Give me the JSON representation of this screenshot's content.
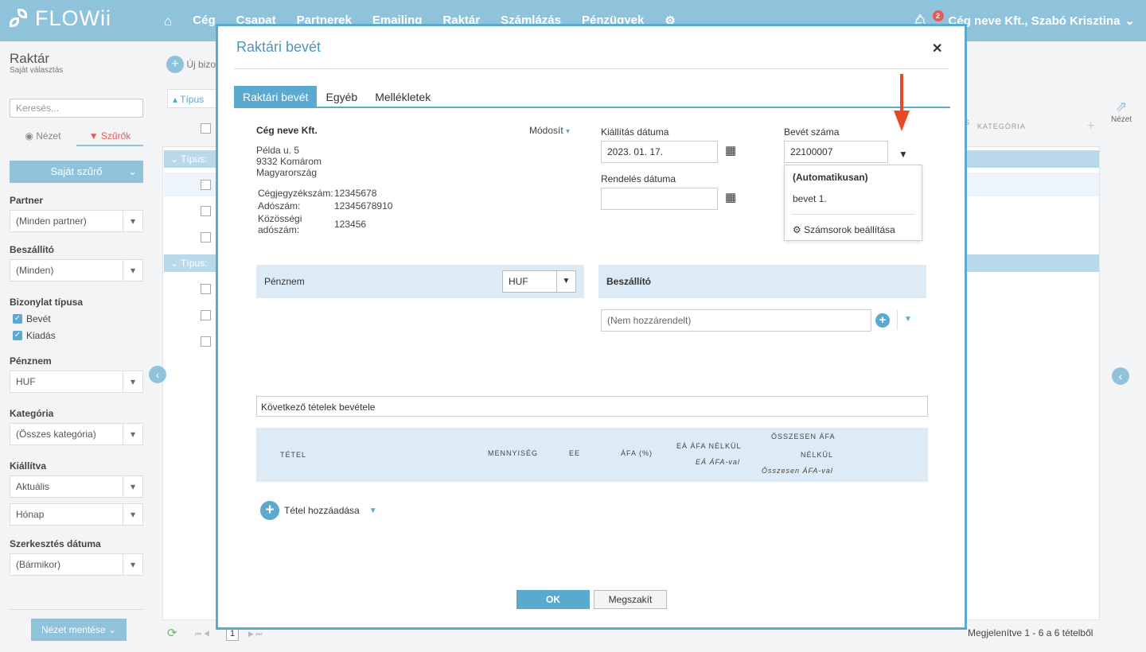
{
  "app": {
    "logo": "FLOWii"
  },
  "nav": {
    "items": [
      "Cég",
      "Csapat",
      "Partnerek",
      "Emailing",
      "Raktár",
      "Számlázás",
      "Pénzügyek"
    ]
  },
  "user": {
    "label": "Cég neve Kft., Szabó Krisztina",
    "notifications": "2"
  },
  "sidebar": {
    "title": "Raktár",
    "subtitle": "Saját választás",
    "search_placeholder": "Keresés...",
    "tab_view": "Nézet",
    "tab_filters": "Szűrők",
    "own_filter": "Saját szűrő",
    "partner_label": "Partner",
    "partner_value": "(Minden partner)",
    "supplier_label": "Beszállító",
    "supplier_value": "(Minden)",
    "doctype_label": "Bizonylat típusa",
    "doctype_in": "Bevét",
    "doctype_out": "Kiadás",
    "currency_label": "Pénznem",
    "currency_value": "HUF",
    "category_label": "Kategória",
    "category_value": "(Összes kategória)",
    "issued_label": "Kiállítva",
    "issued_value1": "Aktuális",
    "issued_value2": "Hónap",
    "edit_label": "Szerkesztés dátuma",
    "edit_value": "(Bármikor)",
    "save_view": "Nézet mentése"
  },
  "background": {
    "new_doc": "Új bizo",
    "type_sort": "Típus",
    "group1": "Típus:",
    "group2": "Típus:",
    "col_category": "KATEGÓRIA",
    "col_partial": "S",
    "view": "Nézet",
    "status": "Megjelenítve 1 - 6 a 6 tételből",
    "page": "1"
  },
  "modal": {
    "title": "Raktári bevét",
    "tabs": [
      "Raktári bevét",
      "Egyéb",
      "Mellékletek"
    ],
    "company": {
      "name": "Cég neve Kft.",
      "modify": "Módosít",
      "addr1": "Példa u. 5",
      "addr2": "9332 Komárom",
      "addr3": "Magyarország",
      "reg_label": "Cégjegyzékszám:",
      "reg_value": "12345678",
      "tax_label": "Adószám:",
      "tax_value": "12345678910",
      "eu_label": "Közösségi adószám:",
      "eu_value": "123456"
    },
    "issue_date_label": "Kiállítás dátuma",
    "issue_date_value": "2023. 01. 17.",
    "order_date_label": "Rendelés dátuma",
    "order_date_value": "",
    "number_label": "Bevét száma",
    "number_value": "22100007",
    "dropdown": {
      "auto": "(Automatikusan)",
      "item": "bevet 1.",
      "settings": "Számsorok beállítása"
    },
    "currency_label": "Pénznem",
    "currency_value": "HUF",
    "supplier_label": "Beszállító",
    "supplier_placeholder": "(Nem hozzárendelt)",
    "items_text": "Következő tételek bevétele",
    "items_header": {
      "item": "TÉTEL",
      "qty": "MENNYISÉG",
      "unit": "EE",
      "vat": "ÁFA (%)",
      "unit_net": "EÁ ÁFA NÉLKÜL",
      "unit_gross": "EÁ ÁFA-val",
      "total_net1": "ÖSSZESEN ÁFA",
      "total_net2": "NÉLKÜL",
      "total_gross": "Összesen ÁFA-val"
    },
    "add_item": "Tétel hozzáadása",
    "ok": "OK",
    "cancel": "Megszakít"
  },
  "colors": {
    "accent": "#5aa9ce",
    "topbar": "#8fc3dc",
    "arrow": "#e84a27"
  }
}
